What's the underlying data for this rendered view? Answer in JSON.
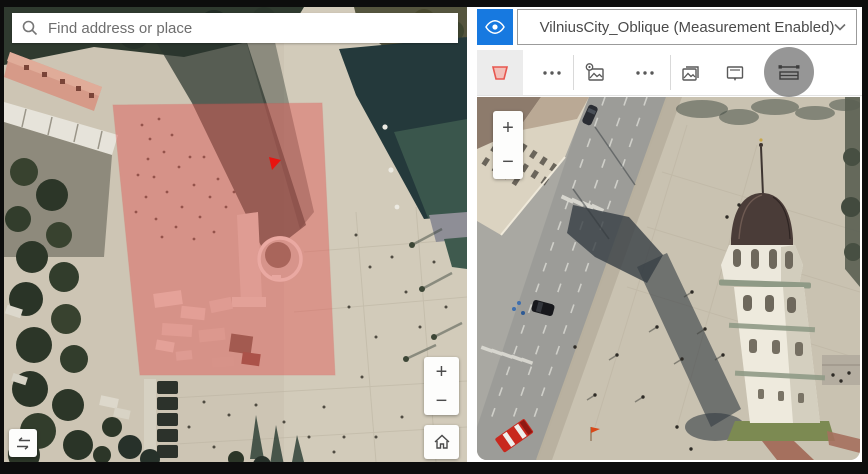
{
  "left_panel": {
    "search": {
      "placeholder": "Find address or place",
      "icon": "search-icon"
    },
    "controls": {
      "zoom_in_label": "+",
      "zoom_out_label": "−",
      "home_icon": "home-icon",
      "swap_icon": "swap-icon"
    },
    "overlay": {
      "shape": "polygon",
      "fill_color": "#e25b57",
      "opacity": 0.47
    }
  },
  "right_panel": {
    "visibility_button": {
      "icon": "eye-icon",
      "accent_color": "#1779e0"
    },
    "layer_dropdown": {
      "value": "VilniusCity_Oblique (Measurement Enabled)",
      "icon": "chevron-down-icon"
    },
    "toolbar": {
      "items": [
        {
          "name": "footprint-filter",
          "state": "active",
          "accent_color": "#e8564e"
        },
        {
          "name": "overflow-menu-left"
        },
        {
          "name": "image-point"
        },
        {
          "name": "overflow-menu-right"
        },
        {
          "name": "image-gallery"
        },
        {
          "name": "image-callout"
        },
        {
          "name": "measure",
          "state": "highlighted",
          "highlight_color": "#787878"
        }
      ]
    },
    "controls": {
      "zoom_in_label": "+",
      "zoom_out_label": "−"
    }
  }
}
